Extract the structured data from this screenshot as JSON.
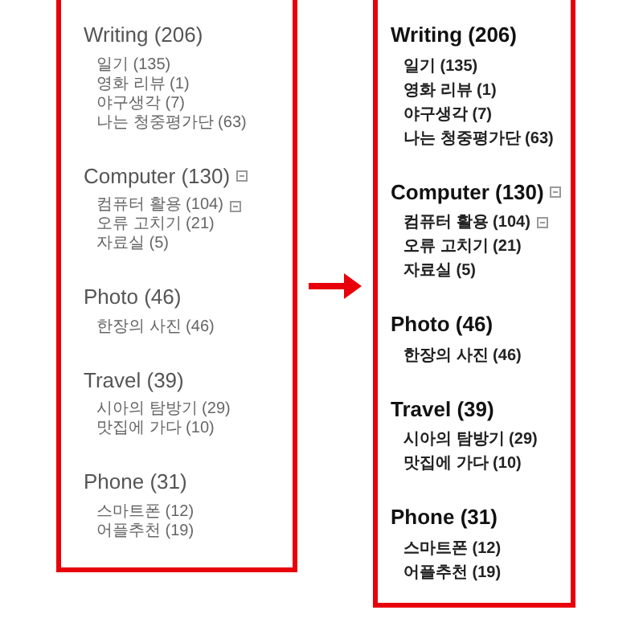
{
  "panels": [
    {
      "kind": "before",
      "categories": [
        {
          "title": "Writing (206)",
          "collapsible": false,
          "children": [
            {
              "label": "일기 (135)",
              "collapsible": false
            },
            {
              "label": "영화 리뷰 (1)",
              "collapsible": false
            },
            {
              "label": "야구생각 (7)",
              "collapsible": false
            },
            {
              "label": "나는 청중평가단 (63)",
              "collapsible": false
            }
          ]
        },
        {
          "title": "Computer (130)",
          "collapsible": true,
          "children": [
            {
              "label": "컴퓨터 활용 (104)",
              "collapsible": true
            },
            {
              "label": "오류 고치기 (21)",
              "collapsible": false
            },
            {
              "label": "자료실 (5)",
              "collapsible": false
            }
          ]
        },
        {
          "title": "Photo (46)",
          "collapsible": false,
          "children": [
            {
              "label": "한장의 사진 (46)",
              "collapsible": false
            }
          ]
        },
        {
          "title": "Travel (39)",
          "collapsible": false,
          "children": [
            {
              "label": "시아의 탐방기 (29)",
              "collapsible": false
            },
            {
              "label": "맛집에 가다 (10)",
              "collapsible": false
            }
          ]
        },
        {
          "title": "Phone (31)",
          "collapsible": false,
          "children": [
            {
              "label": "스마트폰 (12)",
              "collapsible": false
            },
            {
              "label": "어플추천 (19)",
              "collapsible": false
            }
          ]
        }
      ]
    },
    {
      "kind": "after",
      "categories": [
        {
          "title": "Writing (206)",
          "collapsible": false,
          "children": [
            {
              "label": "일기 (135)",
              "collapsible": false
            },
            {
              "label": "영화 리뷰 (1)",
              "collapsible": false
            },
            {
              "label": "야구생각 (7)",
              "collapsible": false
            },
            {
              "label": "나는 청중평가단 (63)",
              "collapsible": false
            }
          ]
        },
        {
          "title": "Computer (130)",
          "collapsible": true,
          "children": [
            {
              "label": "컴퓨터 활용 (104)",
              "collapsible": true
            },
            {
              "label": "오류 고치기 (21)",
              "collapsible": false
            },
            {
              "label": "자료실 (5)",
              "collapsible": false
            }
          ]
        },
        {
          "title": "Photo (46)",
          "collapsible": false,
          "children": [
            {
              "label": "한장의 사진 (46)",
              "collapsible": false
            }
          ]
        },
        {
          "title": "Travel (39)",
          "collapsible": false,
          "children": [
            {
              "label": "시아의 탐방기 (29)",
              "collapsible": false
            },
            {
              "label": "맛집에 가다 (10)",
              "collapsible": false
            }
          ]
        },
        {
          "title": "Phone (31)",
          "collapsible": false,
          "children": [
            {
              "label": "스마트폰 (12)",
              "collapsible": false
            },
            {
              "label": "어플추천 (19)",
              "collapsible": false
            }
          ]
        }
      ]
    }
  ]
}
